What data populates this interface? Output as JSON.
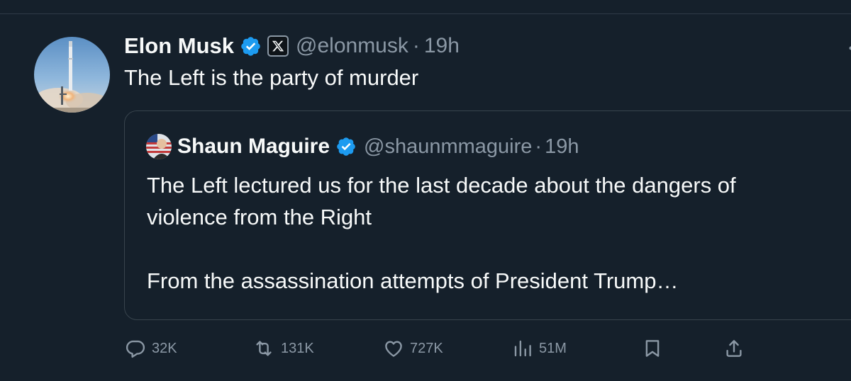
{
  "tweet": {
    "author_name": "Elon Musk",
    "handle": "@elonmusk",
    "separator": "·",
    "time": "19h",
    "text": "The Left is the party of murder",
    "icons": {
      "avatar": "rocket-launch-avatar",
      "verified": "verified-badge-icon",
      "affiliation": "x-logo-icon"
    }
  },
  "quote": {
    "author_name": "Shaun Maguire",
    "handle": "@shaunmmaguire",
    "separator": "·",
    "time": "19h",
    "text_line1": "The Left lectured us for the last decade about the dangers of",
    "text_line2": "violence from the Right",
    "text_line3": "From the assassination attempts of President Trump…"
  },
  "actions": {
    "reply": {
      "icon": "reply-icon",
      "count": "32K"
    },
    "repost": {
      "icon": "repost-icon",
      "count": "131K"
    },
    "like": {
      "icon": "heart-icon",
      "count": "727K"
    },
    "views": {
      "icon": "views-chart-icon",
      "count": "51M"
    },
    "bookmark": {
      "icon": "bookmark-icon"
    },
    "share": {
      "icon": "share-icon"
    }
  },
  "colors": {
    "background": "#15202b",
    "text_primary": "#f7f9f9",
    "text_secondary": "#8b98a5",
    "verified_blue": "#1d9bf0",
    "border": "#38444d"
  }
}
